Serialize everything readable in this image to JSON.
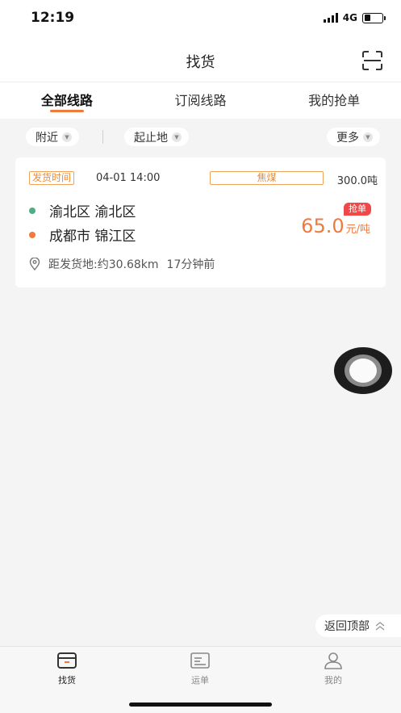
{
  "status_bar": {
    "time": "12:19",
    "network": "4G",
    "battery_level": 0.35
  },
  "nav": {
    "title": "找货",
    "scan_icon": "scan-icon"
  },
  "tabs": [
    {
      "label": "全部线路",
      "active": true
    },
    {
      "label": "订阅线路",
      "active": false
    },
    {
      "label": "我的抢单",
      "active": false
    }
  ],
  "filters": {
    "nearby": "附近",
    "origin_dest": "起止地",
    "more": "更多"
  },
  "cards": [
    {
      "ship_time_label": "发货时间",
      "ship_time": "04-01 14:00",
      "cargo": "焦煤",
      "weight": "300.0吨",
      "origin": "渝北区 渝北区",
      "destination": "成都市 锦江区",
      "grab_badge": "抢单",
      "price_value": "65.0",
      "price_unit": "元/吨",
      "distance": "距发货地:约30.68km",
      "posted": "17分钟前"
    }
  ],
  "back_to_top": "返回顶部",
  "tabbar": [
    {
      "label": "找货",
      "icon": "cargo-box-icon",
      "active": true
    },
    {
      "label": "运单",
      "icon": "waybill-icon",
      "active": false
    },
    {
      "label": "我的",
      "icon": "profile-icon",
      "active": false
    }
  ],
  "colors": {
    "accent": "#f07a3c",
    "origin_dot": "#4caf84",
    "destination_dot": "#f07a3c",
    "badge": "#f04848"
  }
}
